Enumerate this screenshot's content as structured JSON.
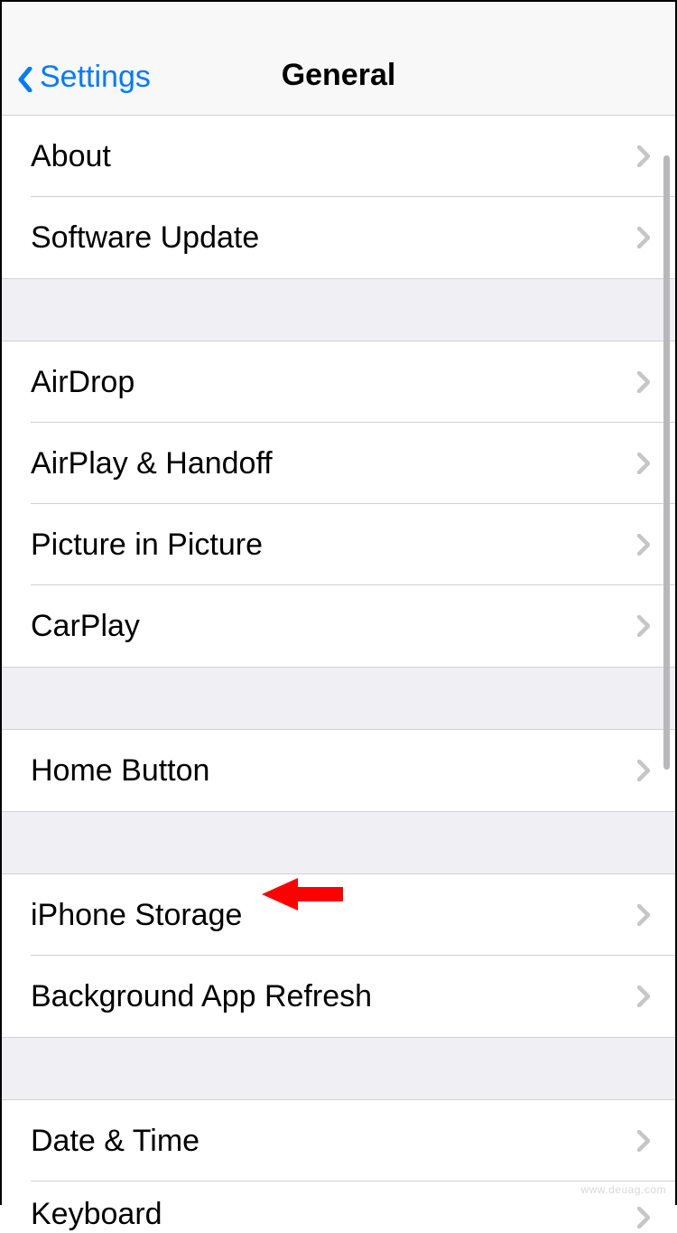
{
  "header": {
    "back_label": "Settings",
    "title": "General"
  },
  "groups": [
    {
      "items": [
        {
          "label": "About",
          "key": "about"
        },
        {
          "label": "Software Update",
          "key": "software-update"
        }
      ]
    },
    {
      "items": [
        {
          "label": "AirDrop",
          "key": "airdrop"
        },
        {
          "label": "AirPlay & Handoff",
          "key": "airplay-handoff"
        },
        {
          "label": "Picture in Picture",
          "key": "pip"
        },
        {
          "label": "CarPlay",
          "key": "carplay"
        }
      ]
    },
    {
      "items": [
        {
          "label": "Home Button",
          "key": "home-button"
        }
      ]
    },
    {
      "items": [
        {
          "label": "iPhone Storage",
          "key": "iphone-storage"
        },
        {
          "label": "Background App Refresh",
          "key": "background-refresh"
        }
      ]
    },
    {
      "items": [
        {
          "label": "Date & Time",
          "key": "date-time"
        },
        {
          "label": "Keyboard",
          "key": "keyboard"
        }
      ]
    }
  ],
  "annotation": {
    "arrow_color": "#ff0000"
  },
  "watermark": "www.deuag.com"
}
